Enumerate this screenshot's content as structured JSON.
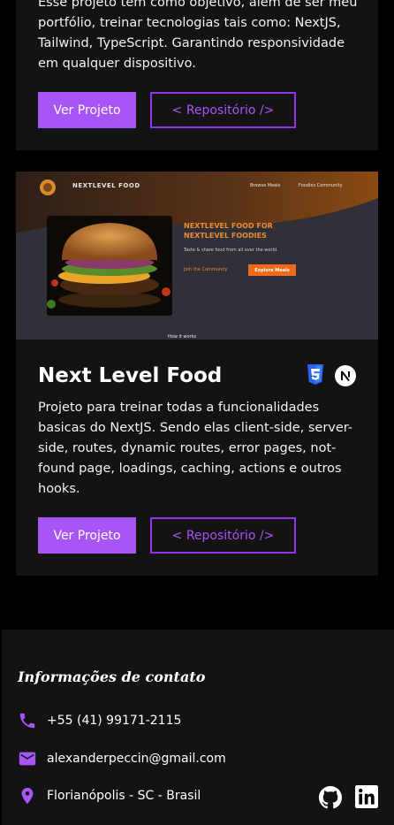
{
  "project1": {
    "description": "Esse projeto tem como objetivo, além de ser meu portfólio, treinar tecnologias tais como: NextJS, Tailwind, TypeScript. Garantindo responsividade em qualquer dispositivo.",
    "view_label": "Ver Projeto",
    "repo_label": "< Repositório />"
  },
  "project2": {
    "preview": {
      "logo_text": "NEXTLEVEL FOOD",
      "nav": [
        "Browse Meals",
        "Foodies Community"
      ],
      "headline_1": "NEXTLEVEL FOOD FOR",
      "headline_2": "NEXTLEVEL FOODIES",
      "tagline": "Taste & share food from all over the world.",
      "join_label": "Join the Community",
      "explore_label": "Explore Meals",
      "bottom_text": "How it works"
    },
    "title": "Next Level Food",
    "tech_icons": [
      "css3-icon",
      "nextjs-icon"
    ],
    "description": "Projeto para treinar todas a funcionalidades basicas do NextJS. Sendo elas client-side, server-side, routes, dynamic routes, error pages, not-found page, loadings, caching, actions e outros hooks.",
    "view_label": "Ver Projeto",
    "repo_label": "< Repositório />"
  },
  "footer": {
    "title": "Informações de contato",
    "phone": "+55 (41) 99171-2115",
    "email": "alexanderpeccin@gmail.com",
    "location": "Florianópolis - SC - Brasil",
    "social_icons": [
      "github-icon",
      "linkedin-icon"
    ]
  },
  "colors": {
    "accent": "#a855f7",
    "card_bg": "#131313",
    "page_bg": "#000000",
    "food_orange": "#f97316"
  }
}
